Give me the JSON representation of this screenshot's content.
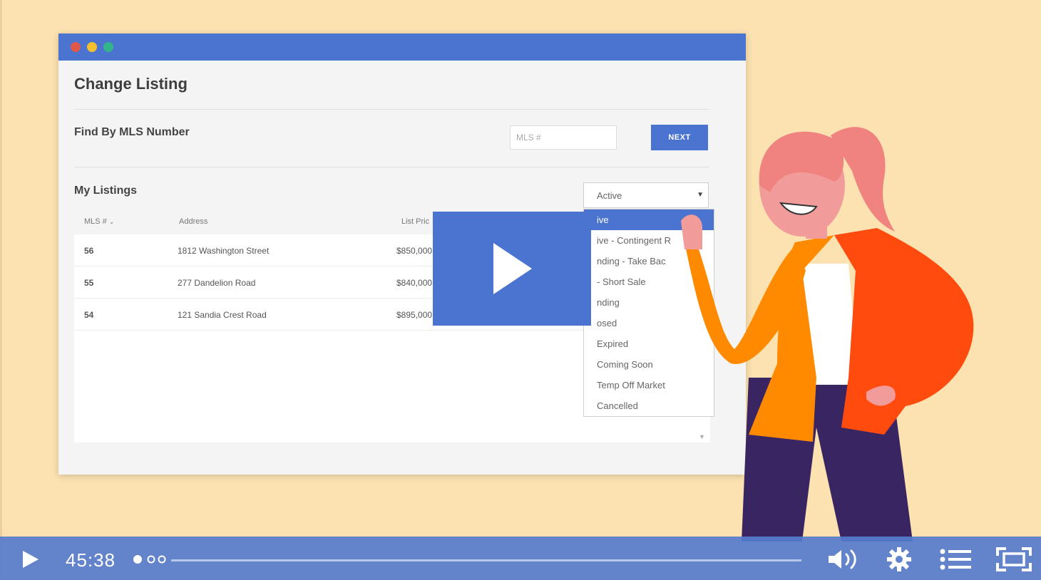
{
  "window": {
    "title": "Change Listing",
    "find_label": "Find By MLS Number",
    "mls_placeholder": "MLS #",
    "next_label": "NEXT",
    "my_listings_label": "My Listings",
    "status_selected": "Active",
    "columns": [
      "MLS #",
      "Address",
      "List Pric"
    ],
    "rows": [
      {
        "mls": "56",
        "address": "1812 Washington Street",
        "price": "$850,000"
      },
      {
        "mls": "55",
        "address": "277 Dandelion Road",
        "price": "$840,000"
      },
      {
        "mls": "54",
        "address": "121 Sandia Crest Road",
        "price": "$895,000"
      }
    ],
    "status_options": [
      "ive",
      "ive - Contingent R",
      "nding - Take Bac",
      "- Short Sale",
      "nding",
      "osed",
      "Expired",
      "Coming Soon",
      "Temp Off Market",
      "Cancelled"
    ]
  },
  "player": {
    "time": "45:38",
    "progress_fraction": 0.0,
    "icons": [
      "play-icon",
      "volume-icon",
      "settings-gear-icon",
      "chapters-list-icon",
      "fullscreen-icon"
    ],
    "accent_color": "#4b74d0"
  }
}
